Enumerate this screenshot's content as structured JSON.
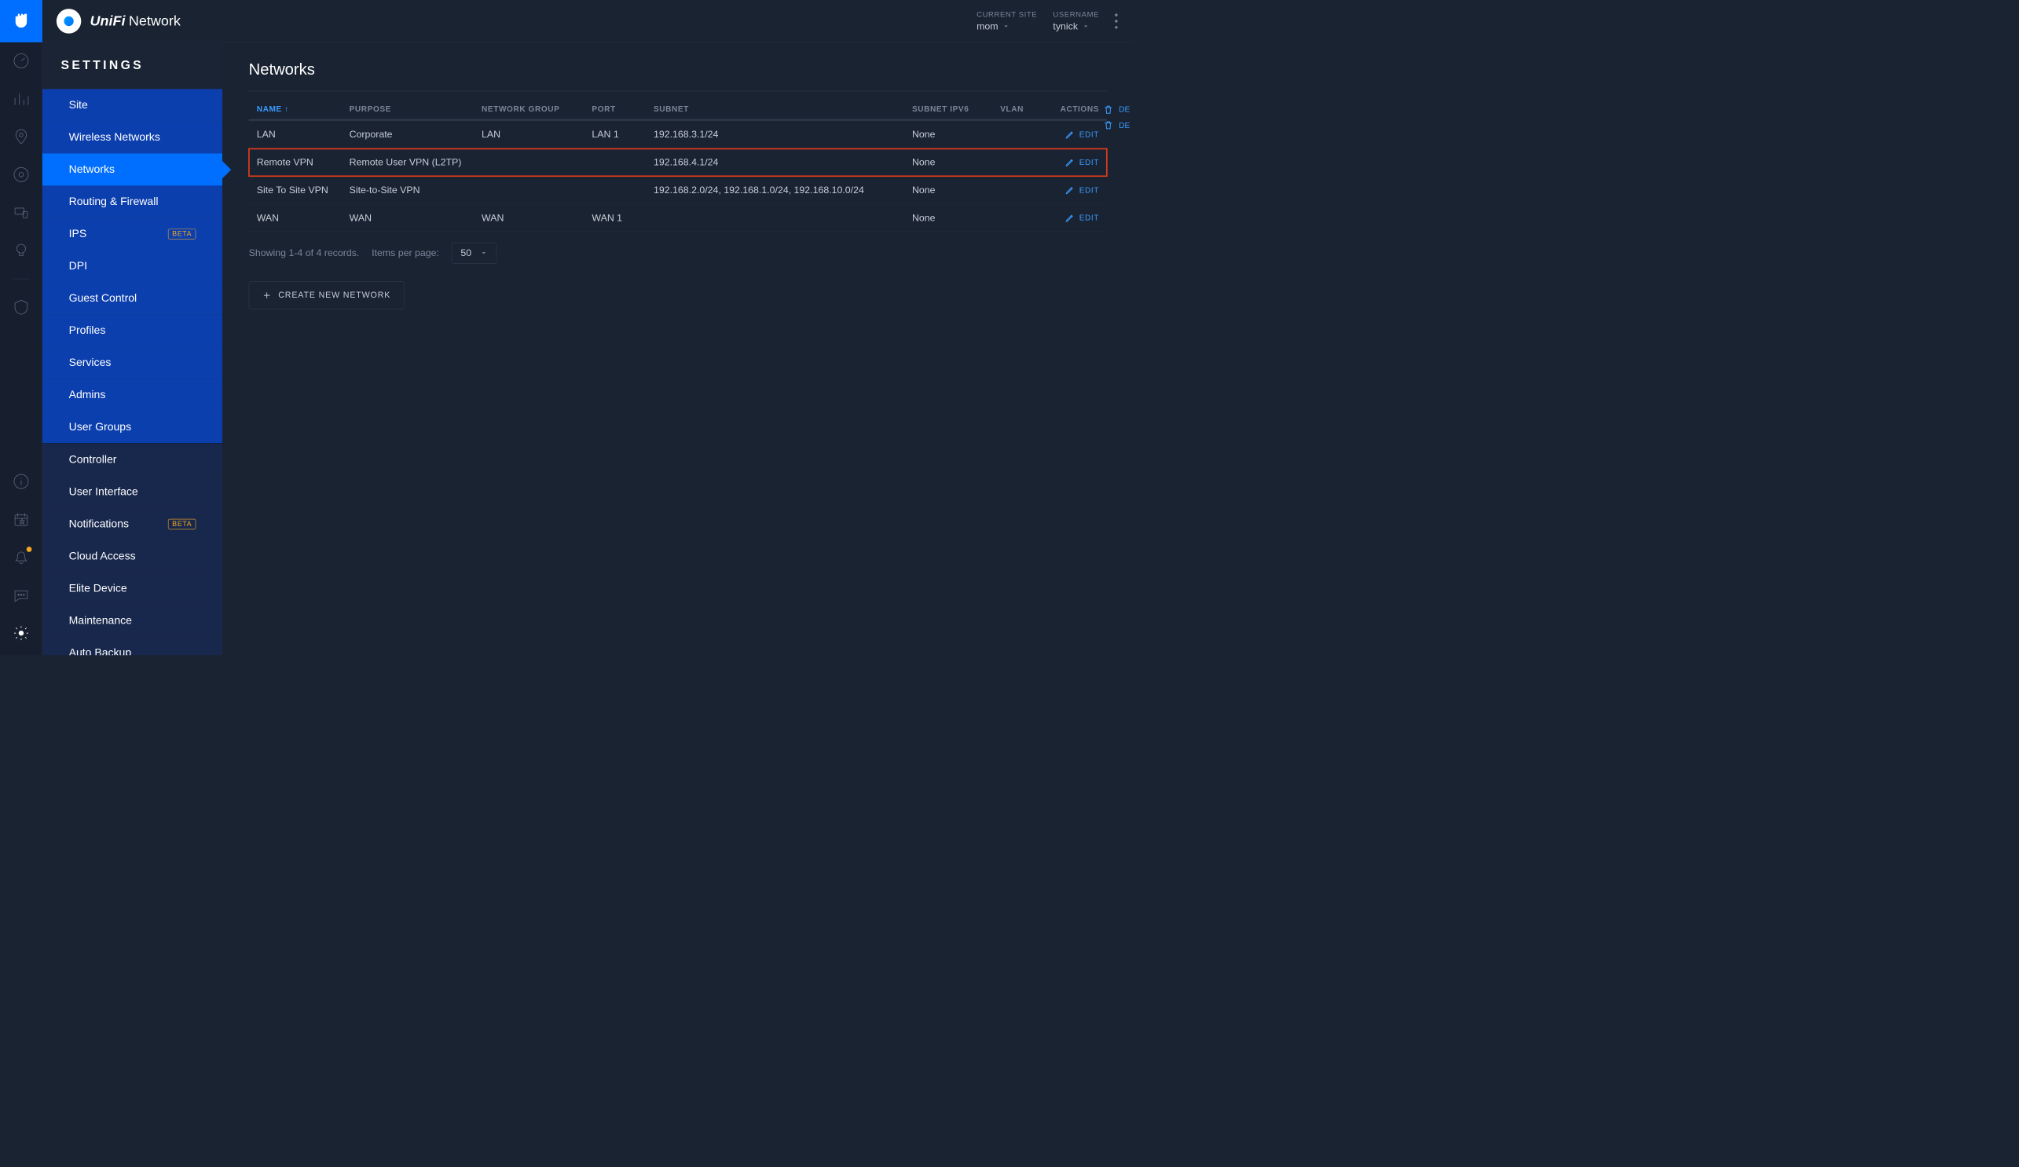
{
  "header": {
    "title_brand": "UniFi",
    "title_rest": "Network",
    "site_label": "CURRENT SITE",
    "site_value": "mom",
    "user_label": "USERNAME",
    "user_value": "tynick"
  },
  "settings": {
    "heading": "SETTINGS",
    "primary_items": [
      {
        "label": "Site",
        "badge": ""
      },
      {
        "label": "Wireless Networks",
        "badge": ""
      },
      {
        "label": "Networks",
        "badge": "",
        "selected": true
      },
      {
        "label": "Routing & Firewall",
        "badge": ""
      },
      {
        "label": "IPS",
        "badge": "BETA"
      },
      {
        "label": "DPI",
        "badge": ""
      },
      {
        "label": "Guest Control",
        "badge": ""
      },
      {
        "label": "Profiles",
        "badge": ""
      },
      {
        "label": "Services",
        "badge": ""
      },
      {
        "label": "Admins",
        "badge": ""
      },
      {
        "label": "User Groups",
        "badge": ""
      }
    ],
    "secondary_items": [
      {
        "label": "Controller",
        "badge": ""
      },
      {
        "label": "User Interface",
        "badge": ""
      },
      {
        "label": "Notifications",
        "badge": "BETA"
      },
      {
        "label": "Cloud Access",
        "badge": ""
      },
      {
        "label": "Elite Device",
        "badge": ""
      },
      {
        "label": "Maintenance",
        "badge": ""
      },
      {
        "label": "Auto Backup",
        "badge": ""
      }
    ]
  },
  "page": {
    "title": "Networks",
    "columns": {
      "name": "NAME",
      "purpose": "PURPOSE",
      "group": "NETWORK GROUP",
      "port": "PORT",
      "subnet": "SUBNET",
      "ipv6": "SUBNET IPV6",
      "vlan": "VLAN",
      "actions": "ACTIONS"
    },
    "rows": [
      {
        "name": "LAN",
        "purpose": "Corporate",
        "group": "LAN",
        "port": "LAN 1",
        "subnet": "192.168.3.1/24",
        "ipv6": "None",
        "vlan": "",
        "edit": "EDIT",
        "highlight": false,
        "deletable": false
      },
      {
        "name": "Remote VPN",
        "purpose": "Remote User VPN (L2TP)",
        "group": "",
        "port": "",
        "subnet": "192.168.4.1/24",
        "ipv6": "None",
        "vlan": "",
        "edit": "EDIT",
        "highlight": true,
        "deletable": true
      },
      {
        "name": "Site To Site VPN",
        "purpose": "Site-to-Site VPN",
        "group": "",
        "port": "",
        "subnet": "192.168.2.0/24, 192.168.1.0/24, 192.168.10.0/24",
        "ipv6": "None",
        "vlan": "",
        "edit": "EDIT",
        "highlight": false,
        "deletable": true
      },
      {
        "name": "WAN",
        "purpose": "WAN",
        "group": "WAN",
        "port": "WAN 1",
        "subnet": "",
        "ipv6": "None",
        "vlan": "",
        "edit": "EDIT",
        "highlight": false,
        "deletable": false
      }
    ],
    "pager_records": "Showing 1-4 of 4 records.",
    "pager_label": "Items per page:",
    "pager_value": "50",
    "create_label": "CREATE NEW NETWORK",
    "overflow_delete": "DE"
  }
}
